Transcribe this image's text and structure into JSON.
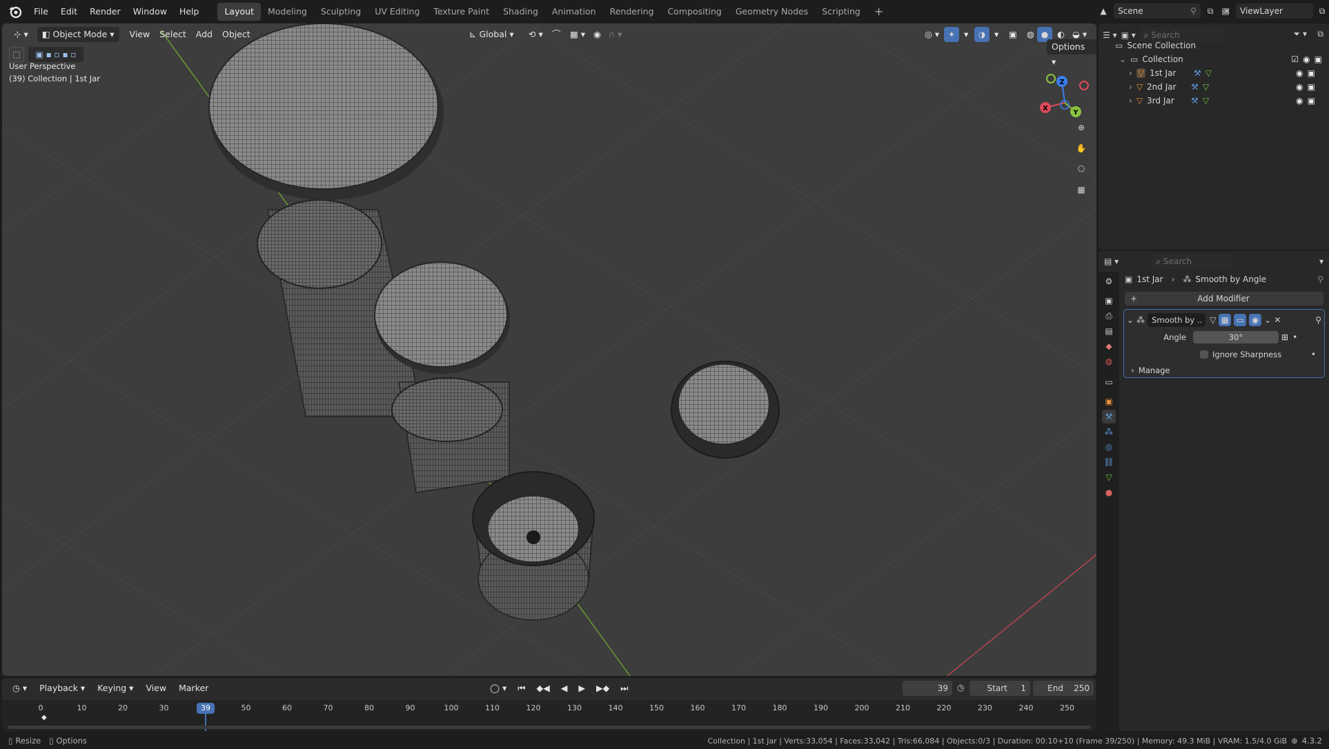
{
  "app": {
    "menus": [
      "File",
      "Edit",
      "Render",
      "Window",
      "Help"
    ],
    "workspaces": [
      "Layout",
      "Modeling",
      "Sculpting",
      "UV Editing",
      "Texture Paint",
      "Shading",
      "Animation",
      "Rendering",
      "Compositing",
      "Geometry Nodes",
      "Scripting"
    ],
    "active_workspace": "Layout",
    "add_workspace_label": "+",
    "scene_name": "Scene",
    "view_layer": "ViewLayer"
  },
  "viewport": {
    "mode": "Object Mode",
    "menus": [
      "View",
      "Select",
      "Add",
      "Object"
    ],
    "orientation": "Global",
    "options_label": "Options",
    "perspective_label": "User Perspective",
    "collection_label": "(39) Collection | 1st Jar",
    "gizmo_axes": [
      "Z",
      "X",
      "Y"
    ]
  },
  "outliner": {
    "search_placeholder": "Search",
    "root": "Scene Collection",
    "collection": "Collection",
    "objects": [
      "1st Jar",
      "2nd Jar",
      "3rd Jar"
    ]
  },
  "properties": {
    "search_placeholder": "Search",
    "breadcrumb_object": "1st Jar",
    "breadcrumb_modifier": "Smooth by Angle",
    "add_modifier_label": "Add Modifier",
    "modifier_name": "Smooth by ...",
    "angle_label": "Angle",
    "angle_value": "30°",
    "ignore_sharpness_label": "Ignore Sharpness",
    "ignore_sharpness_checked": false,
    "manage_label": "Manage"
  },
  "timeline": {
    "menus": [
      "Playback",
      "Keying",
      "View",
      "Marker"
    ],
    "current_frame": "39",
    "start_label": "Start",
    "start_value": "1",
    "end_label": "End",
    "end_value": "250",
    "ruler": [
      "0",
      "10",
      "20",
      "30",
      "50",
      "60",
      "70",
      "80",
      "90",
      "100",
      "110",
      "120",
      "130",
      "140",
      "150",
      "160",
      "170",
      "180",
      "190",
      "200",
      "210",
      "220",
      "230",
      "240",
      "250"
    ]
  },
  "status": {
    "resize_label": "Resize",
    "options_label": "Options",
    "stats": "Collection | 1st Jar | Verts:33,054 | Faces:33,042 | Tris:66,084 | Objects:0/3 | Duration: 00:10+10 (Frame 39/250) | Memory: 49.3 MiB | VRAM: 1.5/4.0 GiB",
    "version": "4.3.2"
  },
  "colors": {
    "accent": "#4772b3",
    "active_frame": "#4772b3",
    "object_orange": "#e8923a",
    "mesh_green": "#6ec33c",
    "modifier_blue": "#5f9ae0",
    "axis_x": "#e04a5a",
    "axis_y": "#8bc53f",
    "axis_z": "#3c7ff0"
  }
}
